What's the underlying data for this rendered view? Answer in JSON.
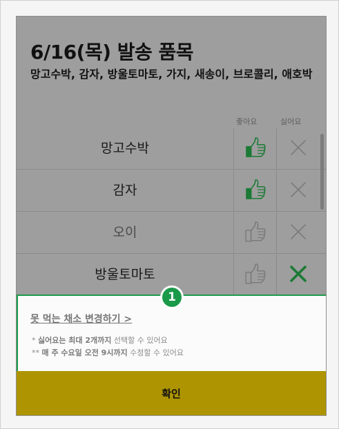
{
  "modal": {
    "title": "6/16(목) 발송 품목",
    "items_summary": "망고수박, 감자, 방울토마토, 가지, 새송이, 브로콜리, 애호박",
    "columns": {
      "like": "좋아요",
      "dislike": "싫어요"
    }
  },
  "rows": [
    {
      "name": "망고수박",
      "like": "selected",
      "dislike": "off"
    },
    {
      "name": "감자",
      "like": "selected",
      "dislike": "off"
    },
    {
      "name": "오이",
      "like": "off",
      "dislike": "off"
    },
    {
      "name": "방울토마토",
      "like": "off",
      "dislike": "selected"
    }
  ],
  "notice": {
    "badge": "1",
    "link_text": "못 먹는 채소 변경하기 >",
    "note1_prefix": "* ",
    "note1_bold": "싫어요는 최대 2개까지",
    "note1_rest": " 선택할 수 있어요",
    "note2_prefix": "** ",
    "note2_bold": "매 주 수요일 오전 9시까지",
    "note2_rest": " 수정할 수 있어요"
  },
  "confirm_label": "확인",
  "colors": {
    "like_active": "#1b7a35",
    "dislike_active": "#1b7a35",
    "inactive_icon": "#7b7b7b",
    "notice_border": "#1b9a4a",
    "confirm_bg": "#ad9400"
  }
}
